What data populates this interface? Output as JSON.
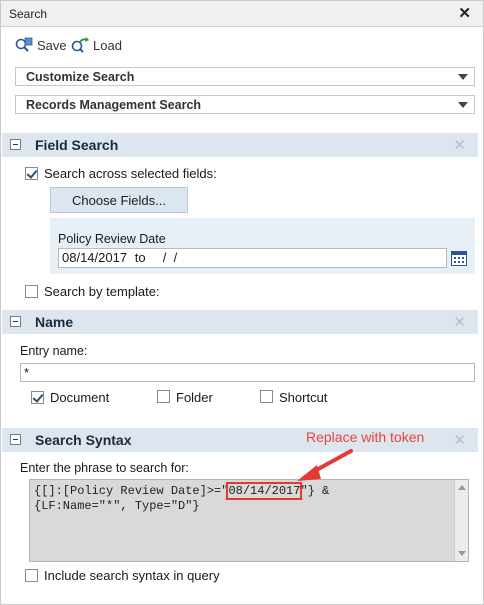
{
  "window": {
    "title": "Search",
    "close_glyph": "✕"
  },
  "toolbar": {
    "save_label": "Save",
    "load_label": "Load",
    "save_icon": "save-icon",
    "load_icon": "load-icon"
  },
  "dropdowns": {
    "customize": "Customize Search",
    "records": "Records Management Search"
  },
  "field_search": {
    "title": "Field Search",
    "across_fields_label": "Search across selected fields:",
    "across_fields_checked": true,
    "choose_fields_button": "Choose Fields...",
    "field_label": "Policy Review Date",
    "date_from": "08/14/2017",
    "date_to_label": "to",
    "date_to": " /  /",
    "template_label": "Search by template:",
    "template_checked": false
  },
  "name": {
    "title": "Name",
    "entry_label": "Entry name:",
    "entry_value": "*",
    "document_label": "Document",
    "document_checked": true,
    "folder_label": "Folder",
    "folder_checked": false,
    "shortcut_label": "Shortcut",
    "shortcut_checked": false
  },
  "syntax": {
    "title": "Search Syntax",
    "prompt": "Enter the phrase to search for:",
    "line1_prefix": "{[]:[Policy Review Date]>=\"",
    "line1_token": "08/14/2017",
    "line1_suffix": "\"} &",
    "line2": "{LF:Name=\"*\", Type=\"D\"}",
    "include_label": "Include search syntax in query",
    "include_checked": false
  },
  "annotation": {
    "text": "Replace with token",
    "color": "#e8453c"
  },
  "colors": {
    "section_header": "#dde6ef",
    "button": "#dbe6f1",
    "accent_red": "#e53935"
  }
}
